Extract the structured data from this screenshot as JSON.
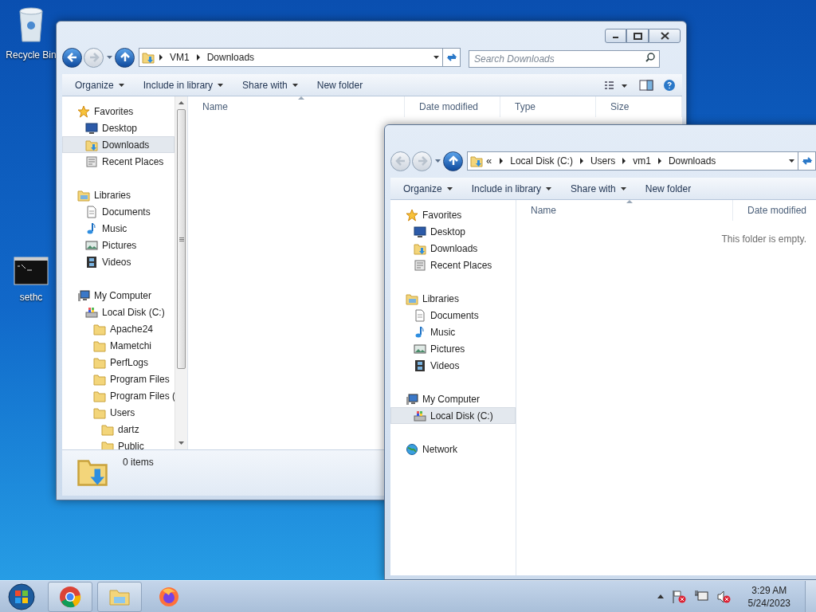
{
  "desktop_icons": [
    {
      "kind": "bin",
      "label": "Recycle Bin"
    },
    {
      "kind": "console",
      "label": "sethc"
    }
  ],
  "windows": [
    {
      "caption_buttons": [
        {
          "kind": "minimize"
        },
        {
          "kind": "maximize"
        },
        {
          "kind": "close"
        }
      ],
      "back_enabled": true,
      "forward_enabled": false,
      "address": {
        "breadcrumbs": [
          "VM1",
          "Downloads"
        ]
      },
      "search": {
        "placeholder": "Search Downloads"
      },
      "toolbar": [
        {
          "label": "Organize",
          "dropdown": true
        },
        {
          "label": "Include in library",
          "dropdown": true
        },
        {
          "label": "Share with",
          "dropdown": true
        },
        {
          "label": "New folder",
          "dropdown": false
        }
      ],
      "toolbar_icons": [
        {
          "kind": "views"
        },
        {
          "kind": "preview"
        },
        {
          "kind": "help"
        }
      ],
      "columns": [
        "Name",
        "Date modified",
        "Type",
        "Size"
      ],
      "nav_scrollbar": true,
      "nav": [
        {
          "label": "Favorites",
          "kind": "star",
          "selected": false,
          "children": [
            {
              "label": "Desktop",
              "kind": "desktop",
              "selected": false
            },
            {
              "label": "Downloads",
              "kind": "downloads",
              "selected": true
            },
            {
              "label": "Recent Places",
              "kind": "recent",
              "selected": false
            }
          ]
        },
        {
          "label": "Libraries",
          "kind": "library",
          "selected": false,
          "children": [
            {
              "label": "Documents",
              "kind": "documents",
              "selected": false
            },
            {
              "label": "Music",
              "kind": "music",
              "selected": false
            },
            {
              "label": "Pictures",
              "kind": "pictures",
              "selected": false
            },
            {
              "label": "Videos",
              "kind": "videos",
              "selected": false
            }
          ]
        },
        {
          "label": "My Computer",
          "kind": "computer",
          "selected": false,
          "children": [
            {
              "label": "Local Disk (C:)",
              "kind": "disk",
              "selected": false,
              "children": [
                {
                  "label": "Apache24",
                  "kind": "folder",
                  "selected": false
                },
                {
                  "label": "Mametchi",
                  "kind": "folder",
                  "selected": false
                },
                {
                  "label": "PerfLogs",
                  "kind": "folder",
                  "selected": false
                },
                {
                  "label": "Program Files",
                  "kind": "folder",
                  "selected": false
                },
                {
                  "label": "Program Files (",
                  "kind": "folder",
                  "selected": false
                },
                {
                  "label": "Users",
                  "kind": "folder",
                  "selected": false,
                  "children": [
                    {
                      "label": "dartz",
                      "kind": "folder",
                      "selected": false
                    },
                    {
                      "label": "Public",
                      "kind": "folder",
                      "selected": false
                    }
                  ]
                }
              ]
            }
          ]
        }
      ],
      "status": {
        "count": "0 items"
      }
    },
    {
      "back_enabled": false,
      "forward_enabled": false,
      "address": {
        "overflow": "«",
        "breadcrumbs": [
          "Local Disk (C:)",
          "Users",
          "vm1",
          "Downloads"
        ]
      },
      "toolbar": [
        {
          "label": "Organize",
          "dropdown": true
        },
        {
          "label": "Include in library",
          "dropdown": true
        },
        {
          "label": "Share with",
          "dropdown": true
        },
        {
          "label": "New folder",
          "dropdown": false
        }
      ],
      "columns": [
        "Name",
        "Date modified"
      ],
      "empty_message": "This folder is empty.",
      "nav_scrollbar": false,
      "nav": [
        {
          "label": "Favorites",
          "kind": "star",
          "selected": false,
          "children": [
            {
              "label": "Desktop",
              "kind": "desktop",
              "selected": false
            },
            {
              "label": "Downloads",
              "kind": "downloads",
              "selected": false
            },
            {
              "label": "Recent Places",
              "kind": "recent",
              "selected": false
            }
          ]
        },
        {
          "label": "Libraries",
          "kind": "library",
          "selected": false,
          "children": [
            {
              "label": "Documents",
              "kind": "documents",
              "selected": false
            },
            {
              "label": "Music",
              "kind": "music",
              "selected": false
            },
            {
              "label": "Pictures",
              "kind": "pictures",
              "selected": false
            },
            {
              "label": "Videos",
              "kind": "videos",
              "selected": false
            }
          ]
        },
        {
          "label": "My Computer",
          "kind": "computer",
          "selected": false,
          "children": [
            {
              "label": "Local Disk (C:)",
              "kind": "disk",
              "selected": true
            }
          ]
        },
        {
          "label": "Network",
          "kind": "network",
          "selected": false
        }
      ]
    }
  ],
  "taskbar": {
    "apps": [
      {
        "kind": "chrome",
        "running": true
      },
      {
        "kind": "explorer",
        "running": true
      },
      {
        "kind": "firefox",
        "running": false
      }
    ],
    "tray_icons": [
      {
        "kind": "show-hidden"
      },
      {
        "kind": "flag-error"
      },
      {
        "kind": "network"
      },
      {
        "kind": "volume-muted"
      }
    ],
    "time": "3:29 AM",
    "date": "5/24/2023"
  }
}
